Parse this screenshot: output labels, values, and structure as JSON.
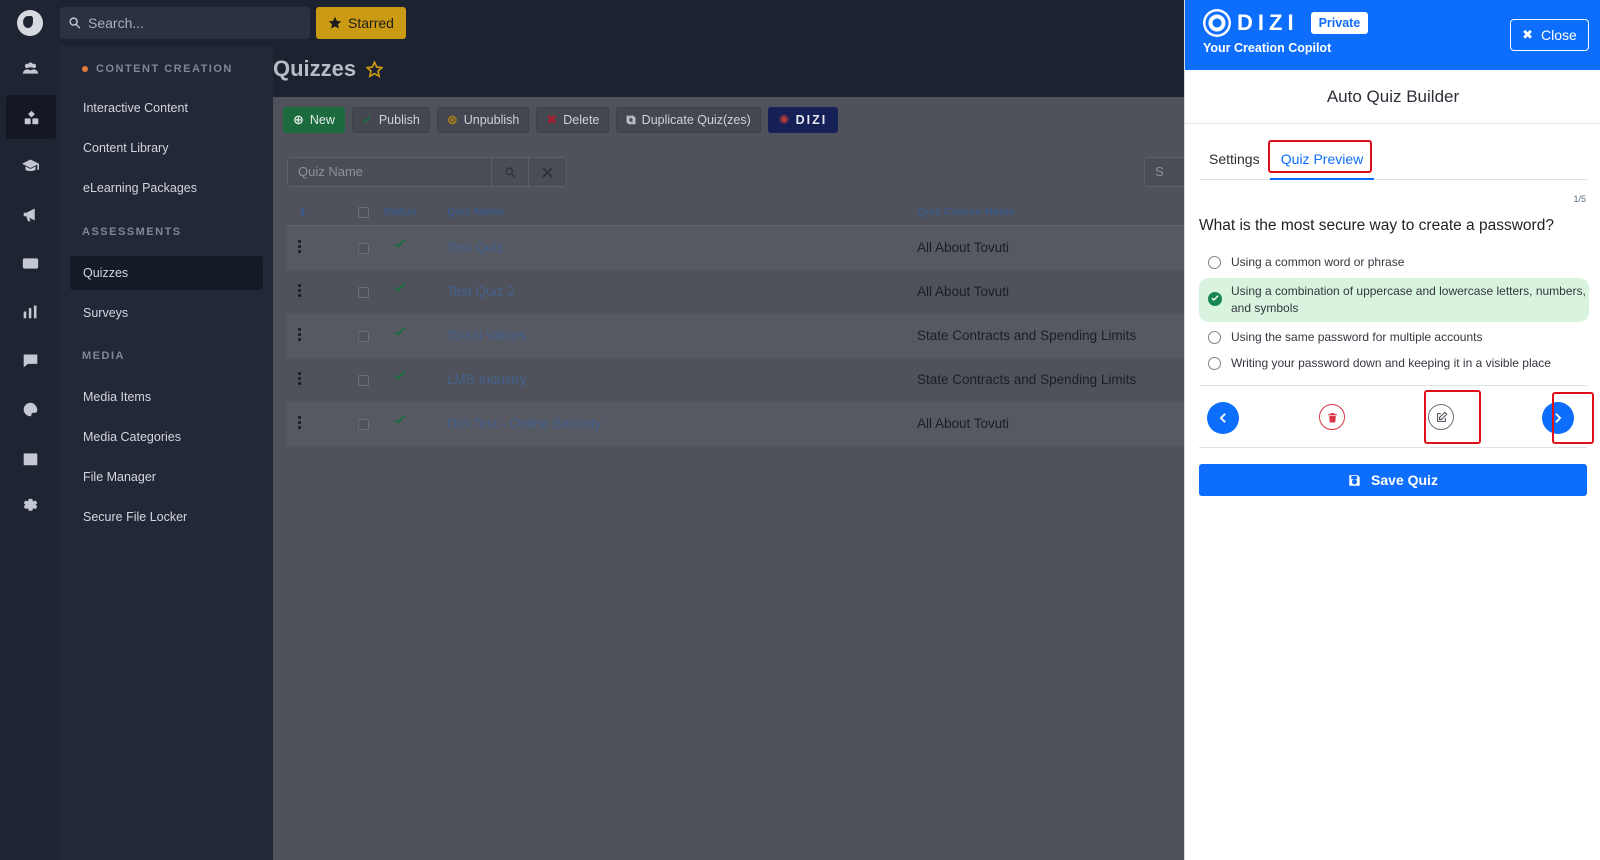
{
  "topbar": {
    "search_placeholder": "Search...",
    "starred_label": "Starred"
  },
  "rail": {
    "icons": [
      "users-icon",
      "content-icon",
      "graduation-cap-icon",
      "megaphone-icon",
      "media-icon",
      "chart-icon",
      "chat-icon",
      "palette-icon",
      "calendar-icon",
      "settings-icon"
    ]
  },
  "nav": {
    "sections": [
      {
        "heading": "CONTENT CREATION",
        "items": [
          "Interactive Content",
          "Content Library",
          "eLearning Packages"
        ]
      },
      {
        "heading": "ASSESSMENTS",
        "items": [
          "Quizzes",
          "Surveys"
        ]
      },
      {
        "heading": "MEDIA",
        "items": [
          "Media Items",
          "Media Categories",
          "File Manager",
          "Secure File Locker"
        ]
      }
    ],
    "active_item": "Quizzes"
  },
  "page": {
    "title": "Quizzes"
  },
  "toolbar": {
    "new_label": "New",
    "publish_label": "Publish",
    "unpublish_label": "Unpublish",
    "delete_label": "Delete",
    "duplicate_label": "Duplicate Quiz(zes)",
    "dizi_label": "DIZI"
  },
  "filter": {
    "placeholder": "Quiz Name",
    "right_stub": "S"
  },
  "table": {
    "columns": {
      "status": "Status",
      "name": "Quiz Name",
      "course": "Quiz Course Name"
    },
    "rows": [
      {
        "name": "Test Quiz",
        "course": "All About Tovuti"
      },
      {
        "name": "Test Quiz 2",
        "course": "All About Tovuti"
      },
      {
        "name": "Tovuti Values",
        "course": "State Contracts and Spending Limits"
      },
      {
        "name": "LMS Industry",
        "course": "State Contracts and Spending Limits"
      },
      {
        "name": "Dizi Test - Online Security",
        "course": "All About Tovuti"
      }
    ]
  },
  "drawer": {
    "brand": "DIZI",
    "badge": "Private",
    "subtitle": "Your Creation Copilot",
    "close_label": "Close",
    "title": "Auto Quiz Builder",
    "tabs": {
      "settings": "Settings",
      "preview": "Quiz Preview"
    },
    "counter": "1/5",
    "question": "What is the most secure way to create a password?",
    "options": [
      "Using a common word or phrase",
      "Using a combination of uppercase and lowercase letters, numbers, and symbols",
      "Using the same password for multiple accounts",
      "Writing your password down and keeping it in a visible place"
    ],
    "correct_index": 1,
    "save_label": "Save Quiz",
    "colors": {
      "accent": "#0d6efd",
      "highlight": "#e0101a",
      "correct_bg": "#d9f4de",
      "danger": "#dc3545"
    }
  }
}
